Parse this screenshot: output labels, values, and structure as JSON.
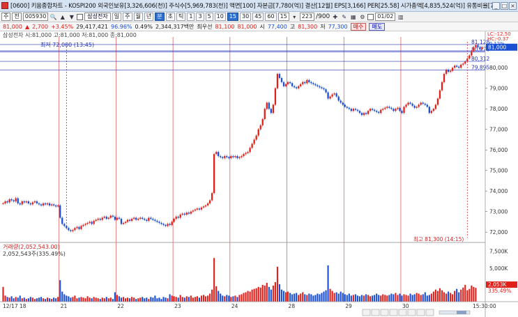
{
  "window": {
    "title": "[0600] 키움종합차트 - KOSPI200 외국인보유[3,326,606(천)] 주식수[5,969,783(천)] 액면[100] 자본금[7,780(억)] 결산[12월] EPS[3,166] PER[25.58] 시가총액[4,835,524(억)] 유통비율[78.8"
  },
  "toolbar": {
    "period_select": "주",
    "market_select": "전",
    "stock_code": "005930",
    "stock_name": "삼성전자",
    "period_buttons": [
      "일",
      "주",
      "월",
      "년"
    ],
    "period_active": "분",
    "min_label": "분",
    "tick_label": "초",
    "tik_label": "틱",
    "intervals": [
      "1",
      "3",
      "5",
      "10",
      "15",
      "30",
      "45",
      "60"
    ],
    "active_interval": "15",
    "interval_select": "15",
    "count": "223",
    "total": "/900",
    "date": "01/02"
  },
  "quote": {
    "price": "81,000",
    "change": "2,700",
    "change_pct": "+3.45%",
    "volume": "29,417,421",
    "rate": "96.96%",
    "amount": "0.49%",
    "value": "2,344,317백만",
    "label_best": "최우선",
    "best_sell": "81,100",
    "best_buy": "81,000",
    "open_label": "시",
    "open": "77,400",
    "high_label": "고",
    "high": "81,300",
    "low_label": "저",
    "low": "77,300",
    "buy_label": "매수",
    "sell_label": "매도"
  },
  "chart_data": {
    "type": "candlestick",
    "legend": "삼성전자 시:81,000 고:81,000 저:81,000 종:81,000",
    "ylim": [
      71600,
      81500
    ],
    "y_ticks": [
      "81,000",
      "80,000",
      "79,000",
      "78,000",
      "77,000",
      "76,000",
      "75,000",
      "74,000",
      "73,000",
      "72,000"
    ],
    "x_labels": [
      "12/17 18",
      "21",
      "22",
      "23",
      "24",
      "28",
      "29",
      "30",
      "15:30:00"
    ],
    "horizontal_lines": [
      {
        "value": 81128,
        "label": "81,128"
      },
      {
        "value": 80776,
        "label": "80,776"
      },
      {
        "value": 80312,
        "label": "80,312"
      },
      {
        "value": 79895,
        "label": "79,895"
      }
    ],
    "low_annotation": "최저 72,000 (13:45)",
    "high_annotation": "최고 81,300 (14:15)",
    "right_tags": [
      "LC:-12.50",
      "HC:-0.37",
      "-0.12%"
    ],
    "current_price": "81,000",
    "price_series": [
      73400,
      73500,
      73450,
      73600,
      73550,
      73500,
      73650,
      73400,
      73350,
      73500,
      73450,
      73500,
      73400,
      73350,
      73450,
      73500,
      73400,
      73350,
      73300,
      73400,
      73350,
      73400,
      73300,
      73350,
      73300,
      73250,
      73300,
      72700,
      72400,
      72300,
      72200,
      72100,
      72050,
      72100,
      72200,
      72250,
      72150,
      72300,
      72350,
      72400,
      72450,
      72500,
      72400,
      72550,
      72600,
      72650,
      72600,
      72700,
      72750,
      72650,
      72700,
      72800,
      72750,
      72600,
      72700,
      72650,
      72400,
      72450,
      72500,
      72600,
      72550,
      72650,
      72700,
      72600,
      72650,
      72700,
      72650,
      72600,
      72550,
      72700,
      72650,
      72600,
      72550,
      72500,
      72450,
      72400,
      72350,
      72300,
      72400,
      72350,
      72500,
      72650,
      72750,
      72700,
      72850,
      72900,
      72850,
      72950,
      72900,
      73000,
      73050,
      73100,
      73150,
      73100,
      73200,
      73250,
      73300,
      73400,
      73550,
      73900,
      75800,
      75900,
      75700,
      75650,
      75600,
      75700,
      75650,
      75600,
      75700,
      75650,
      75700,
      75600,
      75650,
      75700,
      75800,
      75850,
      75900,
      76100,
      76300,
      76500,
      76700,
      77000,
      77200,
      77500,
      78000,
      78300,
      78000,
      77800,
      78200,
      79000,
      79700,
      79500,
      79300,
      79100,
      79200,
      79300,
      79250,
      79100,
      79050,
      79000,
      79100,
      79200,
      79300,
      79250,
      79400,
      79300,
      79250,
      79200,
      79150,
      79100,
      79050,
      79000,
      78950,
      78800,
      78500,
      78600,
      78700,
      78750,
      78600,
      78400,
      78300,
      78200,
      78100,
      78050,
      78000,
      77900,
      78000,
      77950,
      77900,
      77800,
      77700,
      77800,
      77750,
      77900,
      78000,
      77950,
      77900,
      77850,
      77800,
      77950,
      78000,
      78050,
      78100,
      78050,
      78000,
      77900,
      78000,
      78050,
      77900,
      77800,
      78100,
      78200,
      78300,
      78250,
      78150,
      78050,
      78100,
      78200,
      78300,
      78250,
      78200,
      78100,
      77800,
      77900,
      78000,
      78200,
      78500,
      78900,
      79300,
      79700,
      79900,
      79800,
      79850,
      80000,
      80100,
      80050,
      80000,
      80150,
      80200,
      80300,
      80450,
      80600,
      80800,
      81000,
      81100,
      81000,
      80900,
      81000
    ],
    "volume_legend": "거래량(2,052,543.00)",
    "volume_value": "2,052,543주(335.49%)",
    "volume_ticks": [
      "7,500K",
      "5,000K",
      "2,500K"
    ],
    "volume_right_tags": [
      "2,053K",
      "335.49%"
    ],
    "volume_ylim": [
      0,
      8500000
    ],
    "volume_series": [
      2200000,
      900000,
      700000,
      600000,
      800000,
      500000,
      700000,
      600000,
      900000,
      500000,
      600000,
      400000,
      500000,
      700000,
      600000,
      400000,
      500000,
      600000,
      700000,
      500000,
      400000,
      600000,
      500000,
      400000,
      600000,
      500000,
      700000,
      3200000,
      1500000,
      1100000,
      900000,
      800000,
      600000,
      700000,
      900000,
      500000,
      600000,
      700000,
      600000,
      500000,
      800000,
      600000,
      500000,
      700000,
      600000,
      500000,
      400000,
      600000,
      500000,
      700000,
      500000,
      600000,
      400000,
      1400000,
      1000000,
      800000,
      600000,
      700000,
      500000,
      600000,
      500000,
      700000,
      600000,
      400000,
      500000,
      600000,
      700000,
      500000,
      600000,
      400000,
      700000,
      600000,
      900000,
      500000,
      600000,
      400000,
      700000,
      600000,
      500000,
      1100000,
      900000,
      800000,
      700000,
      600000,
      1000000,
      700000,
      600000,
      800000,
      700000,
      900000,
      600000,
      700000,
      800000,
      600000,
      900000,
      1000000,
      800000,
      900000,
      1200000,
      1800000,
      6500000,
      2300000,
      1600000,
      1200000,
      900000,
      800000,
      1000000,
      900000,
      700000,
      800000,
      900000,
      700000,
      1000000,
      1100000,
      1300000,
      1400000,
      1600000,
      1500000,
      1800000,
      1900000,
      2000000,
      2200000,
      2100000,
      2500000,
      2400000,
      2800000,
      2200000,
      1800000,
      2400000,
      2900000,
      5200000,
      2600000,
      1800000,
      1600000,
      1400000,
      1500000,
      1300000,
      1100000,
      1200000,
      1300000,
      1000000,
      1200000,
      1400000,
      1100000,
      1000000,
      1200000,
      1100000,
      900000,
      1000000,
      1200000,
      1100000,
      1300000,
      1500000,
      1700000,
      5400000,
      1900000,
      1600000,
      1300000,
      1400000,
      1200000,
      1500000,
      1300000,
      1100000,
      1000000,
      1200000,
      900000,
      1000000,
      1100000,
      900000,
      800000,
      1000000,
      900000,
      1100000,
      1000000,
      800000,
      900000,
      1000000,
      1200000,
      1000000,
      900000,
      1100000,
      1000000,
      900000,
      1000000,
      1200000,
      1100000,
      1300000,
      1000000,
      1200000,
      900000,
      1100000,
      1000000,
      900000,
      1200000,
      1000000,
      1100000,
      1300000,
      1200000,
      1000000,
      1100000,
      1400000,
      900000,
      1000000,
      1200000,
      1500000,
      1800000,
      1600000,
      2000000,
      1700000,
      1400000,
      1200000,
      1500000,
      1300000,
      1100000,
      1600000,
      1900000,
      1400000,
      1800000,
      2100000,
      2500000,
      1700000,
      1900000,
      2400000,
      2200000,
      2053000
    ]
  }
}
